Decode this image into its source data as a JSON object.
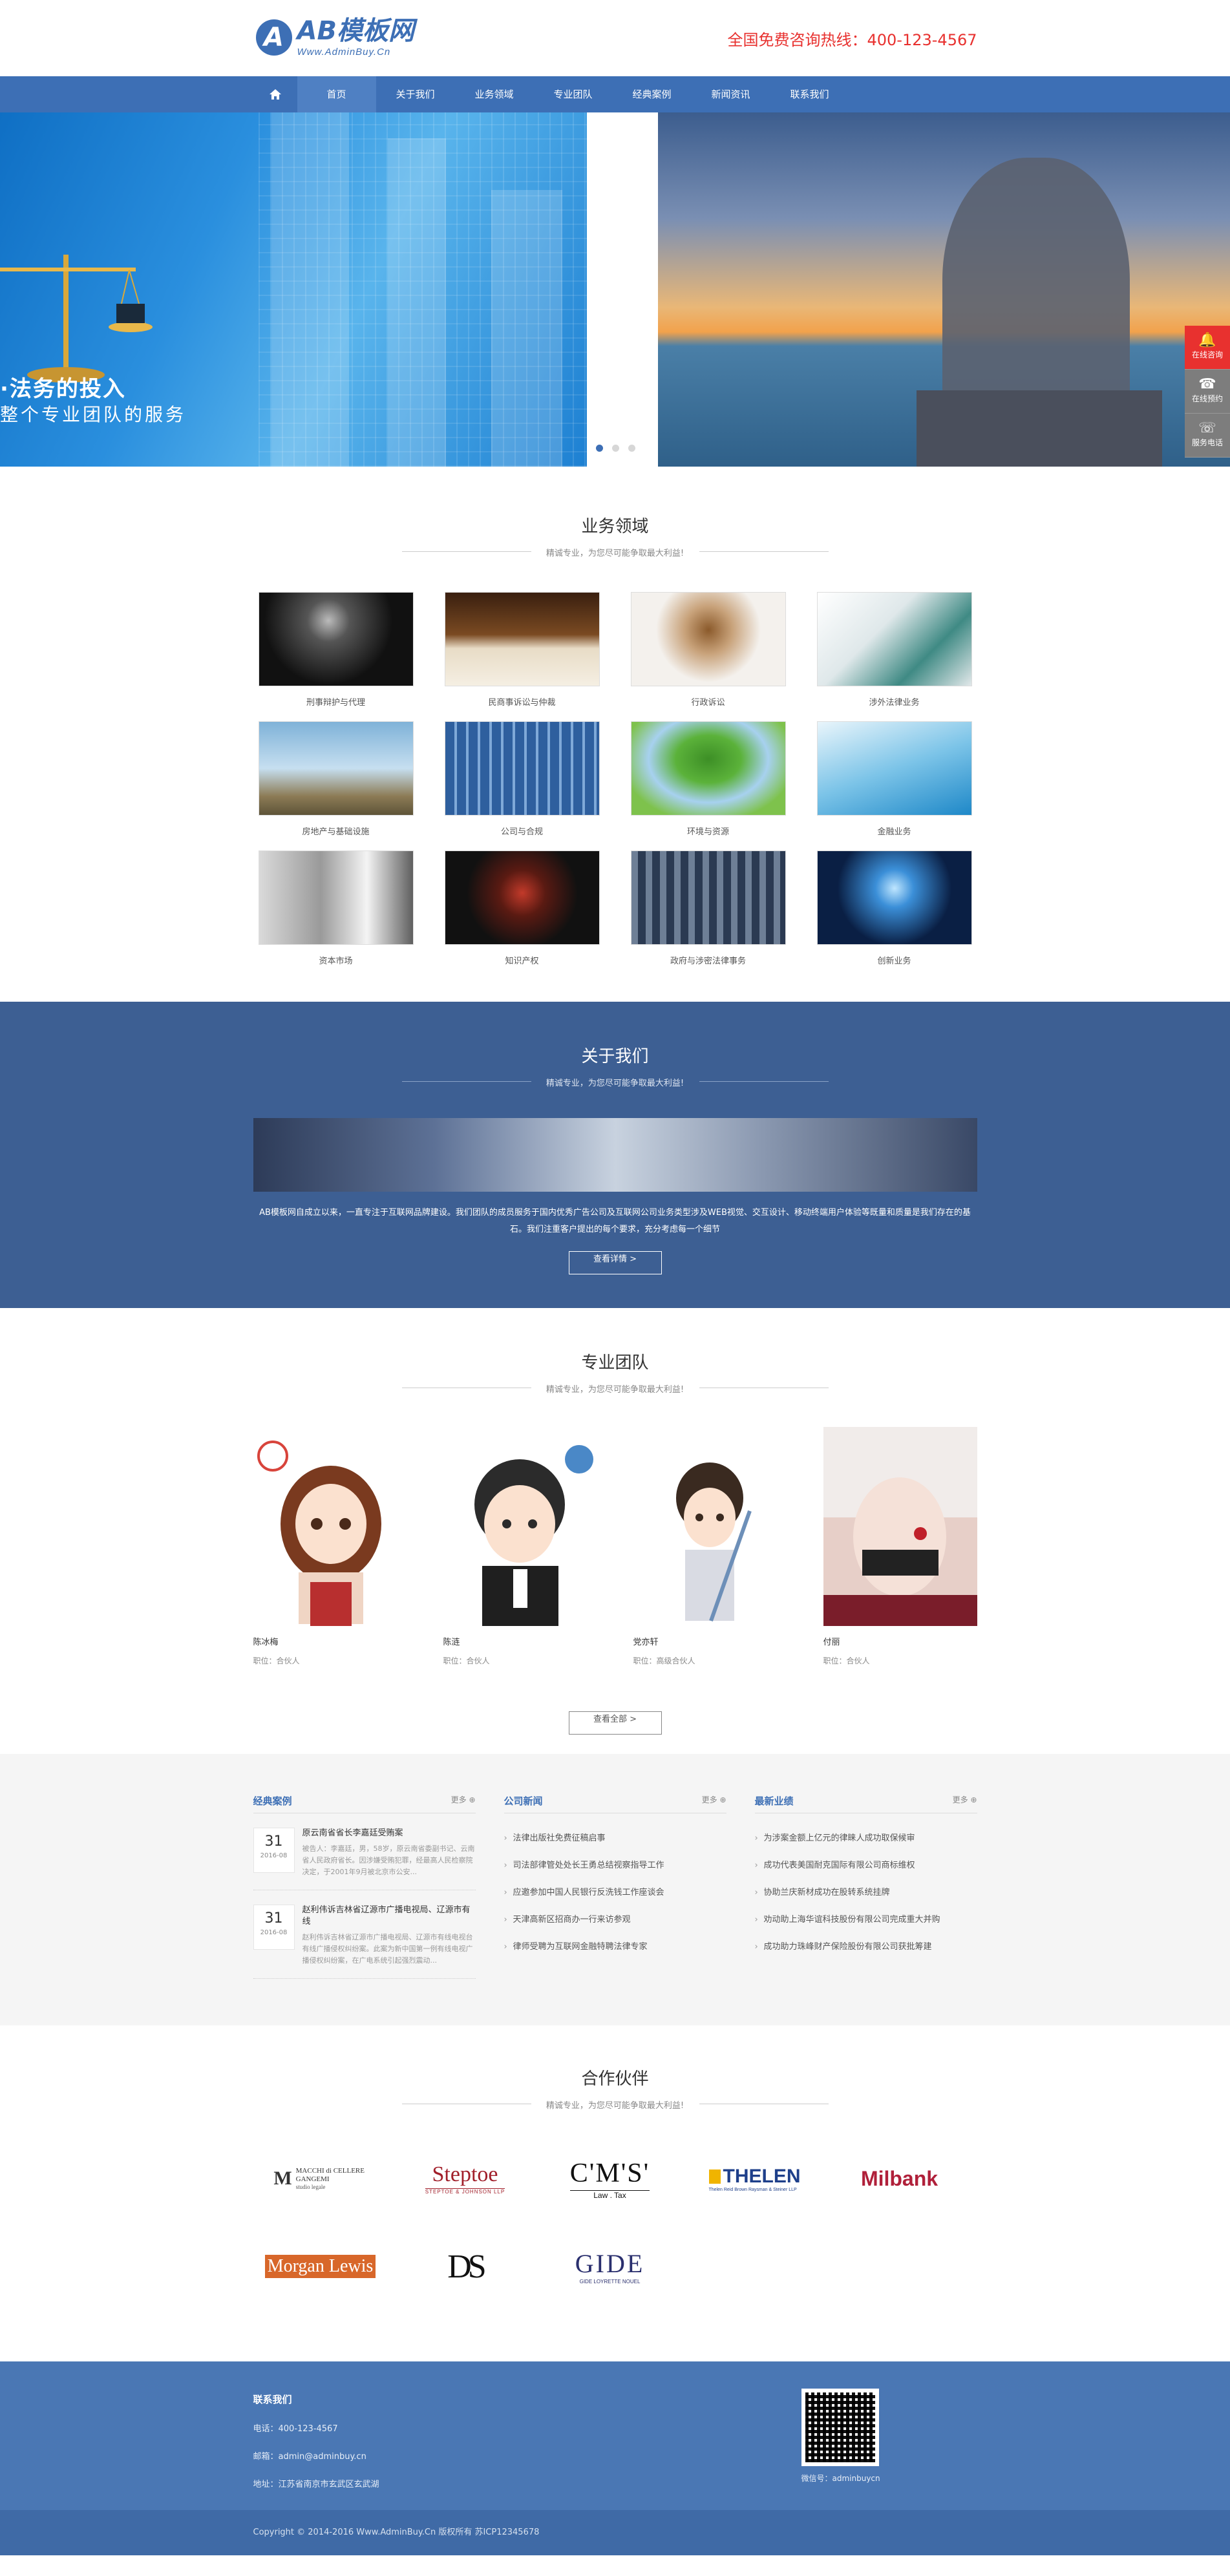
{
  "header": {
    "logo_mark": "A",
    "logo_name": "AB模板网",
    "logo_sub": "Www.AdminBuy.Cn",
    "hotline": "全国免费咨询热线：400-123-4567"
  },
  "nav": {
    "items": [
      {
        "label": "首页"
      },
      {
        "label": "关于我们"
      },
      {
        "label": "业务领域"
      },
      {
        "label": "专业团队"
      },
      {
        "label": "经典案例"
      },
      {
        "label": "新闻资讯"
      },
      {
        "label": "联系我们"
      }
    ]
  },
  "banner": {
    "line1": "·法务的投入",
    "line2": "整个专业团队的服务",
    "slide_count": 3,
    "active_slide": 1
  },
  "side_float": {
    "items": [
      {
        "label": "在线咨询",
        "icon": "bell-icon"
      },
      {
        "label": "在线预约",
        "icon": "headset-icon"
      },
      {
        "label": "服务电话",
        "icon": "phone-icon"
      }
    ]
  },
  "business": {
    "title": "业务领域",
    "subtitle": "精诚专业，为您尽可能争取最大利益!",
    "items": [
      {
        "label": "刑事辩护与代理"
      },
      {
        "label": "民商事诉讼与仲裁"
      },
      {
        "label": "行政诉讼"
      },
      {
        "label": "涉外法律业务"
      },
      {
        "label": "房地产与基础设施"
      },
      {
        "label": "公司与合规"
      },
      {
        "label": "环境与资源"
      },
      {
        "label": "金融业务"
      },
      {
        "label": "资本市场"
      },
      {
        "label": "知识产权"
      },
      {
        "label": "政府与涉密法律事务"
      },
      {
        "label": "创新业务"
      }
    ]
  },
  "about": {
    "title": "关于我们",
    "subtitle": "精诚专业，为您尽可能争取最大利益!",
    "text": "AB模板网自成立以来，一直专注于互联网品牌建设。我们团队的成员服务于国内优秀广告公司及互联网公司业务类型涉及WEB视觉、交互设计、移动终端用户体验等既量和质量是我们存在的基石。我们注重客户提出的每个要求，充分考虑每一个细节",
    "button": "查看详情 >"
  },
  "team": {
    "title": "专业团队",
    "subtitle": "精诚专业，为您尽可能争取最大利益!",
    "members": [
      {
        "name": "陈冰梅",
        "role": "职位：合伙人"
      },
      {
        "name": "陈涟",
        "role": "职位：合伙人"
      },
      {
        "name": "党亦轩",
        "role": "职位：高级合伙人"
      },
      {
        "name": "付丽",
        "role": "职位：合伙人"
      }
    ],
    "button": "查看全部 >"
  },
  "news": {
    "cases": {
      "title": "经典案例",
      "more": "更多 ⊕",
      "items": [
        {
          "day": "31",
          "month": "2016-08",
          "title": "原云南省省长李嘉廷受贿案",
          "desc": "被告人：李嘉廷，男，58岁，原云南省委副书记、云南省人民政府省长。因涉嫌受贿犯罪，经最高人民检察院决定，于2001年9月被北京市公安..."
        },
        {
          "day": "31",
          "month": "2016-08",
          "title": "赵利伟诉吉林省辽源市广播电视局、辽源市有线",
          "desc": "赵利伟诉吉林省辽源市广播电视局、辽源市有线电视台有线广播侵权纠纷案。此案为新中国第一例有线电视广播侵权纠纷案，在广电系统引起强烈震动..."
        }
      ]
    },
    "company": {
      "title": "公司新闻",
      "more": "更多 ⊕",
      "items": [
        "法律出版社免费征稿启事",
        "司法部律管处处长王勇总结视察指导工作",
        "应邀参加中国人民银行反洗钱工作座谈会",
        "天津高新区招商办一行来访参观",
        "律师受聘为互联网金融特聘法律专家"
      ]
    },
    "latest": {
      "title": "最新业绩",
      "more": "更多 ⊕",
      "items": [
        "为涉案金额上亿元的律睐人成功取保候审",
        "成功代表美国耐克国际有限公司商标维权",
        "协助兰庆新材成功在股转系统挂牌",
        "劝动助上海华谊科技股份有限公司完成重大并购",
        "成功助力珠峰财产保险股份有限公司获批筹建"
      ]
    }
  },
  "partners": {
    "title": "合作伙伴",
    "subtitle": "精诚专业，为您尽可能争取最大利益!",
    "logos": [
      {
        "name": "MACCHI di CELLERE GANGEMI",
        "sub": "studio legale"
      },
      {
        "name": "Steptoe",
        "sub": "STEPTOE & JOHNSON LLP"
      },
      {
        "name": "C'M'S'",
        "sub": "Law . Tax"
      },
      {
        "name": "THELEN",
        "sub": "Thelen Reid Brown Raysman & Steiner LLP"
      },
      {
        "name": "Milbank",
        "sub": ""
      },
      {
        "name": "Morgan Lewis",
        "sub": ""
      },
      {
        "name": "DS",
        "sub": ""
      },
      {
        "name": "GIDE",
        "sub": "GIDE LOYRETTE NOUEL"
      }
    ]
  },
  "footer": {
    "title": "联系我们",
    "phone": "电话：400-123-4567",
    "email": "邮箱：admin@adminbuy.cn",
    "address": "地址：江苏省南京市玄武区玄武湖",
    "qr_caption": "微信号：adminbuycn",
    "copyright": "Copyright © 2014-2016 Www.AdminBuy.Cn 版权所有    苏ICP12345678"
  }
}
